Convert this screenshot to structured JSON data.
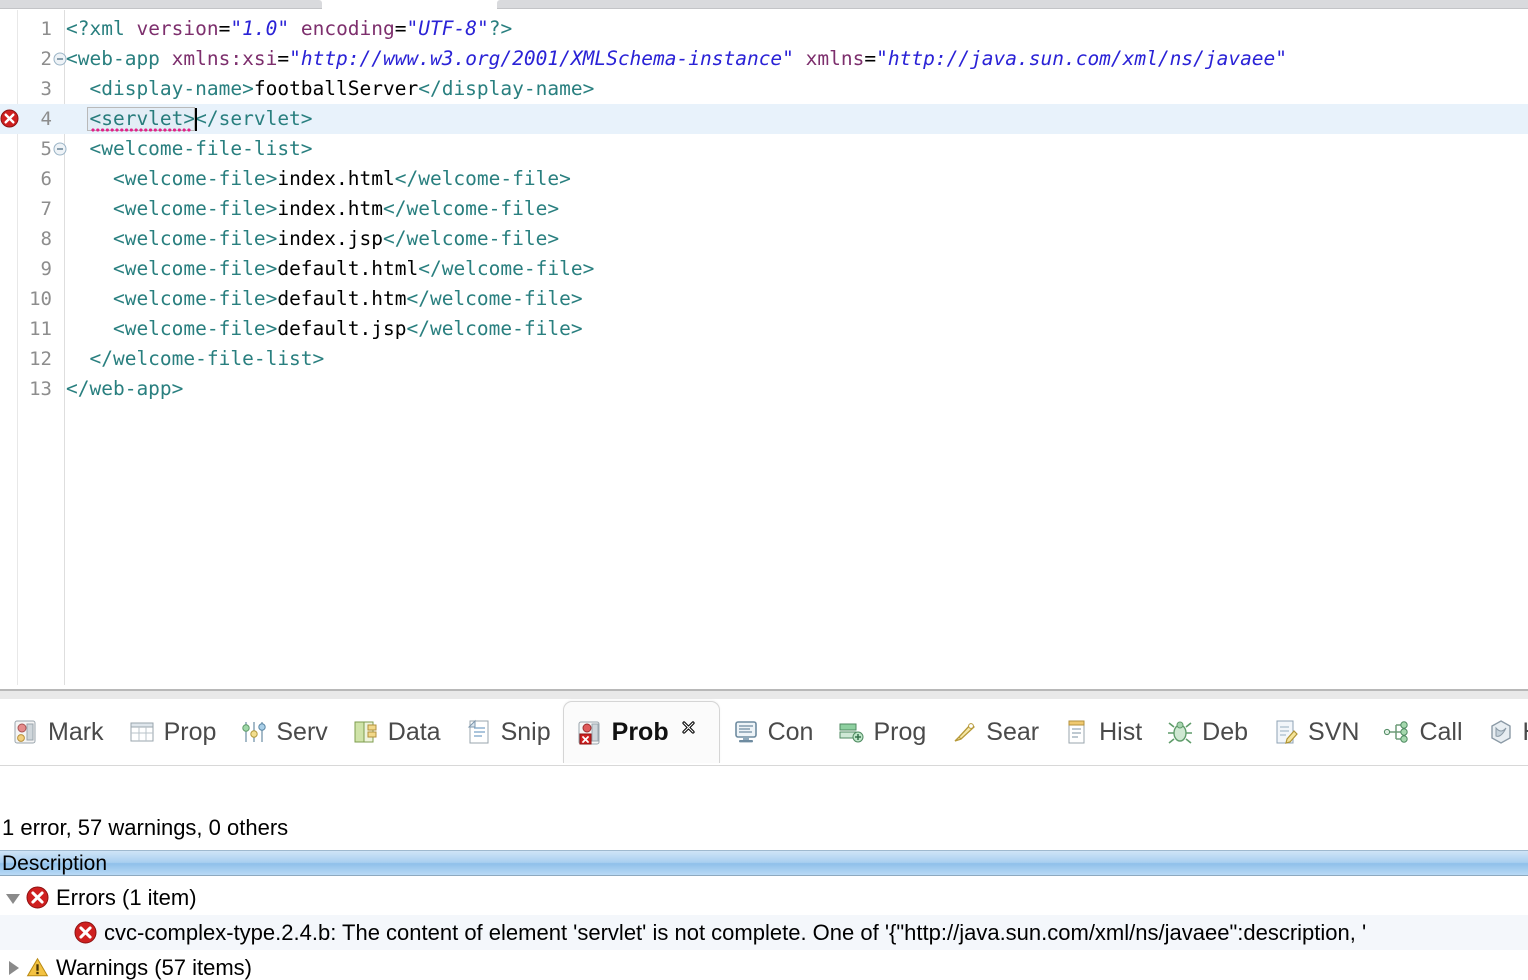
{
  "editor": {
    "lines": [
      {
        "num": "1",
        "fold": "none",
        "marker": "none",
        "current": false,
        "segments": [
          {
            "t": "<?xml ",
            "c": "pi"
          },
          {
            "t": "version",
            "c": "attr"
          },
          {
            "t": "=",
            "c": "txt"
          },
          {
            "t": "\"1.0\"",
            "c": "val"
          },
          {
            "t": " ",
            "c": "txt"
          },
          {
            "t": "encoding",
            "c": "attr"
          },
          {
            "t": "=",
            "c": "txt"
          },
          {
            "t": "\"UTF-8\"",
            "c": "val"
          },
          {
            "t": "?>",
            "c": "pi"
          }
        ]
      },
      {
        "num": "2",
        "fold": "collapse",
        "marker": "none",
        "current": false,
        "segments": [
          {
            "t": "<web-app ",
            "c": "tag"
          },
          {
            "t": "xmlns:xsi",
            "c": "attr"
          },
          {
            "t": "=",
            "c": "txt"
          },
          {
            "t": "\"http://www.w3.org/2001/XMLSchema-instance\"",
            "c": "val"
          },
          {
            "t": " ",
            "c": "txt"
          },
          {
            "t": "xmlns",
            "c": "attr"
          },
          {
            "t": "=",
            "c": "txt"
          },
          {
            "t": "\"http://java.sun.com/xml/ns/javaee\"",
            "c": "val"
          }
        ]
      },
      {
        "num": "3",
        "fold": "none",
        "marker": "none",
        "current": false,
        "segments": [
          {
            "t": "  <display-name>",
            "c": "tag"
          },
          {
            "t": "footballServer",
            "c": "txt"
          },
          {
            "t": "</display-name>",
            "c": "tag"
          }
        ]
      },
      {
        "num": "4",
        "fold": "none",
        "marker": "error",
        "current": true,
        "segments": [
          {
            "t": "  <servlet>",
            "c": "tag"
          },
          {
            "t": "</servlet>",
            "c": "tag"
          }
        ]
      },
      {
        "num": "5",
        "fold": "collapse",
        "marker": "none",
        "current": false,
        "segments": [
          {
            "t": "  <welcome-file-list>",
            "c": "tag"
          }
        ]
      },
      {
        "num": "6",
        "fold": "none",
        "marker": "none",
        "current": false,
        "segments": [
          {
            "t": "    <welcome-file>",
            "c": "tag"
          },
          {
            "t": "index.html",
            "c": "txt"
          },
          {
            "t": "</welcome-file>",
            "c": "tag"
          }
        ]
      },
      {
        "num": "7",
        "fold": "none",
        "marker": "none",
        "current": false,
        "segments": [
          {
            "t": "    <welcome-file>",
            "c": "tag"
          },
          {
            "t": "index.htm",
            "c": "txt"
          },
          {
            "t": "</welcome-file>",
            "c": "tag"
          }
        ]
      },
      {
        "num": "8",
        "fold": "none",
        "marker": "none",
        "current": false,
        "segments": [
          {
            "t": "    <welcome-file>",
            "c": "tag"
          },
          {
            "t": "index.jsp",
            "c": "txt"
          },
          {
            "t": "</welcome-file>",
            "c": "tag"
          }
        ]
      },
      {
        "num": "9",
        "fold": "none",
        "marker": "none",
        "current": false,
        "segments": [
          {
            "t": "    <welcome-file>",
            "c": "tag"
          },
          {
            "t": "default.html",
            "c": "txt"
          },
          {
            "t": "</welcome-file>",
            "c": "tag"
          }
        ]
      },
      {
        "num": "10",
        "fold": "none",
        "marker": "none",
        "current": false,
        "segments": [
          {
            "t": "    <welcome-file>",
            "c": "tag"
          },
          {
            "t": "default.htm",
            "c": "txt"
          },
          {
            "t": "</welcome-file>",
            "c": "tag"
          }
        ]
      },
      {
        "num": "11",
        "fold": "none",
        "marker": "none",
        "current": false,
        "segments": [
          {
            "t": "    <welcome-file>",
            "c": "tag"
          },
          {
            "t": "default.jsp",
            "c": "txt"
          },
          {
            "t": "</welcome-file>",
            "c": "tag"
          }
        ]
      },
      {
        "num": "12",
        "fold": "none",
        "marker": "none",
        "current": false,
        "segments": [
          {
            "t": "  </welcome-file-list>",
            "c": "tag"
          }
        ]
      },
      {
        "num": "13",
        "fold": "none",
        "marker": "none",
        "current": false,
        "segments": [
          {
            "t": "</web-app>",
            "c": "tag"
          }
        ]
      }
    ]
  },
  "view_tabs": [
    {
      "label": "Mark",
      "icon": "markers-icon",
      "active": false
    },
    {
      "label": "Prop",
      "icon": "properties-icon",
      "active": false
    },
    {
      "label": "Serv",
      "icon": "servers-icon",
      "active": false
    },
    {
      "label": "Data",
      "icon": "data-source-icon",
      "active": false
    },
    {
      "label": "Snip",
      "icon": "snippets-icon",
      "active": false
    },
    {
      "label": "Prob",
      "icon": "problems-icon",
      "active": true
    },
    {
      "label": "Con",
      "icon": "console-icon",
      "active": false
    },
    {
      "label": "Prog",
      "icon": "progress-icon",
      "active": false
    },
    {
      "label": "Sear",
      "icon": "search-icon",
      "active": false
    },
    {
      "label": "Hist",
      "icon": "history-icon",
      "active": false
    },
    {
      "label": "Deb",
      "icon": "debug-icon",
      "active": false
    },
    {
      "label": "SVN",
      "icon": "svn-icon",
      "active": false
    },
    {
      "label": "Call",
      "icon": "call-hierarchy-icon",
      "active": false
    },
    {
      "label": "Hib",
      "icon": "hibernate-icon",
      "active": false
    }
  ],
  "problems": {
    "summary": "1 error, 57 warnings, 0 others",
    "column_header": "Description",
    "rows": [
      {
        "type": "group",
        "icon": "error-icon",
        "twisty": "expanded",
        "label": "Errors (1 item)",
        "selected": false
      },
      {
        "type": "item",
        "icon": "error-icon",
        "twisty": "none",
        "label": "cvc-complex-type.2.4.b: The content of element 'servlet' is not complete. One of '{\"http://java.sun.com/xml/ns/javaee\":description, '",
        "selected": true
      },
      {
        "type": "group",
        "icon": "warning-icon",
        "twisty": "collapsed",
        "label": "Warnings (57 items)",
        "selected": false
      }
    ]
  },
  "colors": {
    "tag": "#297f7f",
    "attribute": "#7d2f6d",
    "value": "#2a22d6",
    "current_line": "#e8f2fb",
    "error_red": "#d32020",
    "warning_amber": "#f0b41f",
    "squiggle": "#e0218a",
    "header_blue": "#8fc0ea"
  }
}
